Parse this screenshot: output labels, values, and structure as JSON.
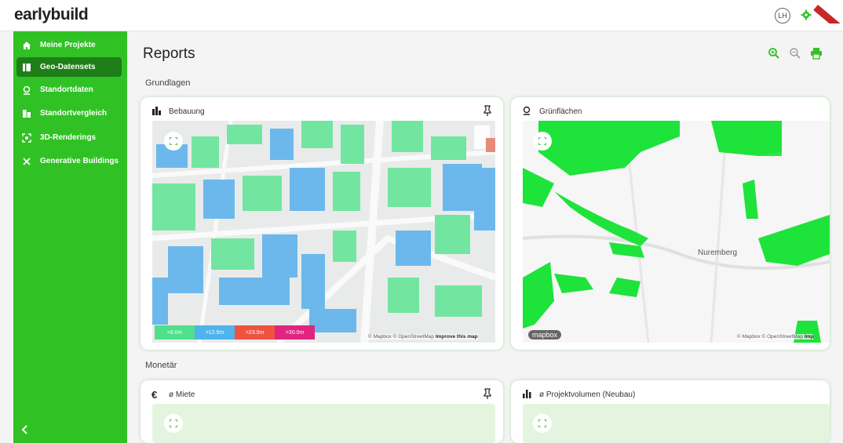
{
  "app": {
    "logo": "earlybuild",
    "user_initials": "LH"
  },
  "colors": {
    "sidebar": "#30c224",
    "sidebar_active": "#1e7f18",
    "map_green": "#1ee33a",
    "bldg_green": "#72e6a0",
    "bldg_blue": "#6cb8ec"
  },
  "sidebar": {
    "items": [
      {
        "label": "Meine Projekte",
        "icon": "home-icon",
        "active": false
      },
      {
        "label": "Geo-Datensets",
        "icon": "map-book-icon",
        "active": true
      },
      {
        "label": "Standortdaten",
        "icon": "location-pin-icon",
        "active": false
      },
      {
        "label": "Standortvergleich",
        "icon": "compare-icon",
        "active": false
      },
      {
        "label": "3D-Renderings",
        "icon": "3d-view-icon",
        "active": false
      },
      {
        "label": "Generative Buildings",
        "icon": "tools-icon",
        "active": false
      }
    ]
  },
  "main": {
    "title": "Reports",
    "sections": [
      "Grundlagen",
      "Monetär"
    ],
    "cards": [
      {
        "title": "Bebauung",
        "icon": "buildings-icon"
      },
      {
        "title": "Grünflächen",
        "icon": "location-pin-icon"
      },
      {
        "title": "ø Miete",
        "icon": "euro-icon"
      },
      {
        "title": "ø Projektvolumen (Neubau)",
        "icon": "bar-chart-icon"
      }
    ],
    "legend": [
      {
        "label": ">0.0m",
        "color": "#4ee08a"
      },
      {
        "label": ">12.5m",
        "color": "#4fb3ec"
      },
      {
        "label": ">23.0m",
        "color": "#ef5340"
      },
      {
        "label": ">30.0m",
        "color": "#e0247f"
      }
    ],
    "map1_attribution": {
      "text": "© Mapbox © OpenStreetMap",
      "link": "Improve this map"
    },
    "map2_attribution": {
      "text": "© Mapbox © OpenStreetMap",
      "link": "Imp"
    },
    "map2_city_label": "Nuremberg",
    "map2_logo": "mapbox"
  }
}
